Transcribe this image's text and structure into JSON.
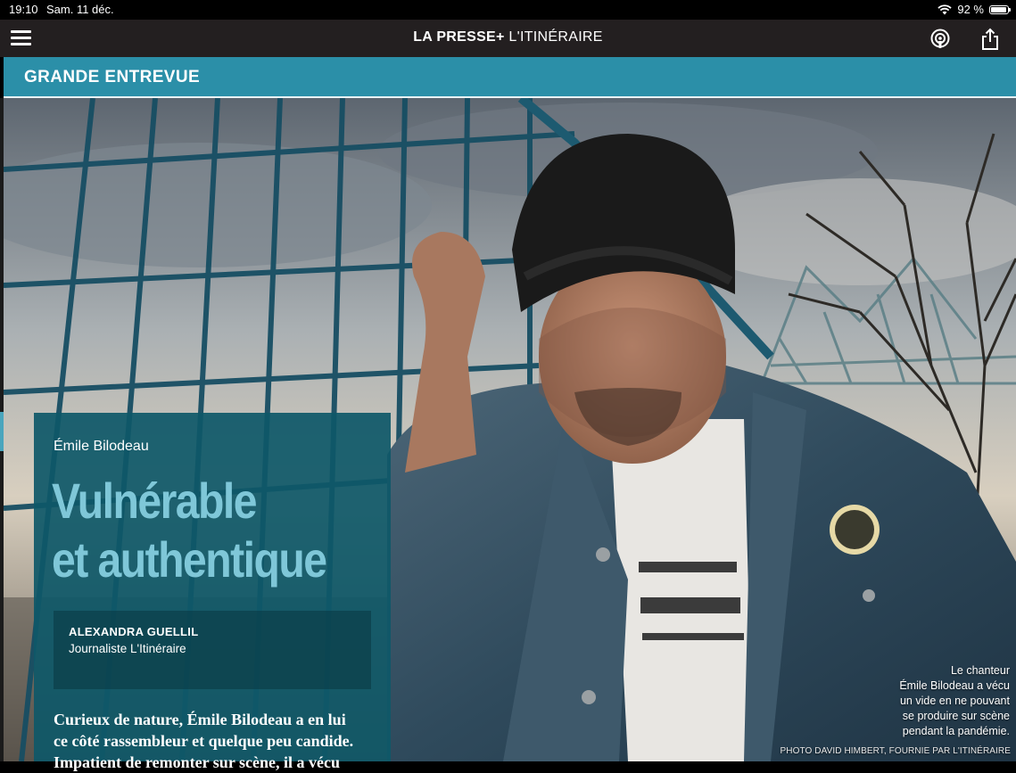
{
  "status_bar": {
    "time": "19:10",
    "date": "Sam. 11 déc.",
    "battery": "92 %",
    "battery_level": 0.92
  },
  "app_bar": {
    "brand_bold": "LA PRESSE+",
    "brand_sub": "L'ITINÉRAIRE",
    "icons": {
      "menu": "hamburger-menu-icon",
      "podcast": "podcast-icon",
      "share": "share-icon"
    }
  },
  "section": {
    "label": "GRANDE ENTREVUE",
    "color": "#2b8fa8"
  },
  "article": {
    "subject": "Émile Bilodeau",
    "headline_line1": "Vulnérable",
    "headline_line2": "et authentique",
    "author": "ALEXANDRA GUELLIL",
    "author_role": "Journaliste L'Itinéraire",
    "lede_line1": "Curieux de nature, Émile Bilodeau a en lui",
    "lede_line2": "ce côté rassembleur et quelque peu candide.",
    "lede_line3": "Impatient de remonter sur scène, il a vécu",
    "headline_color": "#7fc7d8",
    "panel_color": "#0e5868"
  },
  "photo": {
    "caption_lines": [
      "Le chanteur",
      "Émile Bilodeau a vécu",
      "un vide en ne pouvant",
      "se produire sur scène",
      "pendant la pandémie."
    ],
    "credit": "PHOTO DAVID HIMBERT, FOURNIE PAR L'ITINÉRAIRE"
  }
}
